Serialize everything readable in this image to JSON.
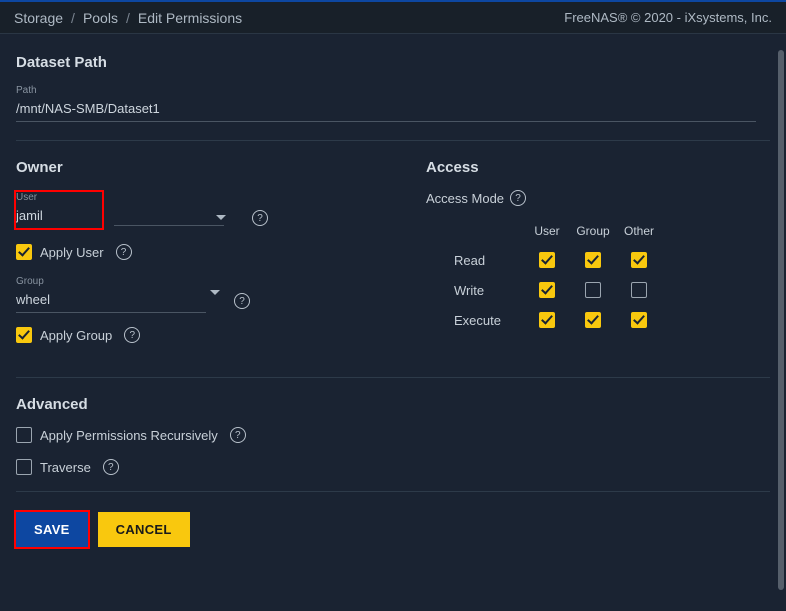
{
  "breadcrumb": {
    "a": "Storage",
    "b": "Pools",
    "c": "Edit Permissions"
  },
  "copyright": "FreeNAS® © 2020 - iXsystems, Inc.",
  "datasetPath": {
    "title": "Dataset Path",
    "pathLabel": "Path",
    "pathValue": "/mnt/NAS-SMB/Dataset1"
  },
  "owner": {
    "title": "Owner",
    "userLabel": "User",
    "userValue": "jamil",
    "applyUser": "Apply User",
    "groupLabel": "Group",
    "groupValue": "wheel",
    "applyGroup": "Apply Group"
  },
  "access": {
    "title": "Access",
    "modeLabel": "Access Mode",
    "cols": {
      "user": "User",
      "group": "Group",
      "other": "Other"
    },
    "rows": {
      "read": "Read",
      "write": "Write",
      "execute": "Execute"
    }
  },
  "advanced": {
    "title": "Advanced",
    "recursive": "Apply Permissions Recursively",
    "traverse": "Traverse"
  },
  "buttons": {
    "save": "SAVE",
    "cancel": "CANCEL"
  }
}
